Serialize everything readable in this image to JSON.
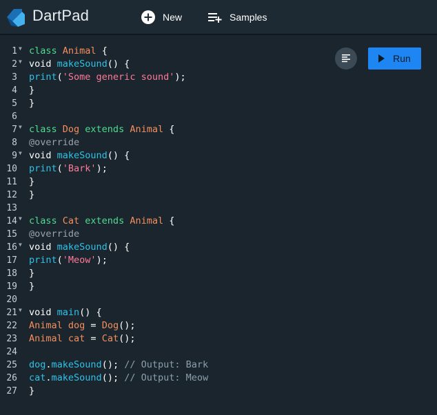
{
  "header": {
    "title": "DartPad",
    "new_label": "New",
    "samples_label": "Samples"
  },
  "toolbar": {
    "run_label": "Run",
    "format_icon": "format-align-icon"
  },
  "colors": {
    "keyword": "#4fdc91",
    "type": "#f58f5e",
    "function": "#2fc2e8",
    "string": "#ff7a99",
    "comment": "#8aa0ad",
    "run_button": "#1d86f2"
  },
  "code": {
    "lines": [
      {
        "n": "1",
        "fold": true,
        "parts": [
          [
            "kw",
            "class "
          ],
          [
            "ty",
            "Animal"
          ],
          [
            "pl",
            " {"
          ]
        ]
      },
      {
        "n": "2",
        "fold": true,
        "parts": [
          [
            "vd",
            "void "
          ],
          [
            "fn",
            "makeSound"
          ],
          [
            "pl",
            "() {"
          ]
        ]
      },
      {
        "n": "3",
        "fold": false,
        "parts": [
          [
            "fn",
            "print"
          ],
          [
            "pl",
            "("
          ],
          [
            "str",
            "'Some generic sound'"
          ],
          [
            "pl",
            ");"
          ]
        ]
      },
      {
        "n": "4",
        "fold": false,
        "parts": [
          [
            "pl",
            "}"
          ]
        ]
      },
      {
        "n": "5",
        "fold": false,
        "parts": [
          [
            "pl",
            "}"
          ]
        ]
      },
      {
        "n": "6",
        "fold": false,
        "parts": []
      },
      {
        "n": "7",
        "fold": true,
        "parts": [
          [
            "kw",
            "class "
          ],
          [
            "ty",
            "Dog "
          ],
          [
            "kw",
            "extends "
          ],
          [
            "ty",
            "Animal"
          ],
          [
            "pl",
            " {"
          ]
        ]
      },
      {
        "n": "8",
        "fold": false,
        "parts": [
          [
            "an",
            "@override"
          ]
        ]
      },
      {
        "n": "9",
        "fold": true,
        "parts": [
          [
            "vd",
            "void "
          ],
          [
            "fn",
            "makeSound"
          ],
          [
            "pl",
            "() {"
          ]
        ]
      },
      {
        "n": "10",
        "fold": false,
        "parts": [
          [
            "fn",
            "print"
          ],
          [
            "pl",
            "("
          ],
          [
            "str",
            "'Bark'"
          ],
          [
            "pl",
            ");"
          ]
        ]
      },
      {
        "n": "11",
        "fold": false,
        "parts": [
          [
            "pl",
            "}"
          ]
        ]
      },
      {
        "n": "12",
        "fold": false,
        "parts": [
          [
            "pl",
            "}"
          ]
        ]
      },
      {
        "n": "13",
        "fold": false,
        "parts": []
      },
      {
        "n": "14",
        "fold": true,
        "parts": [
          [
            "kw",
            "class "
          ],
          [
            "ty",
            "Cat "
          ],
          [
            "kw",
            "extends "
          ],
          [
            "ty",
            "Animal"
          ],
          [
            "pl",
            " {"
          ]
        ]
      },
      {
        "n": "15",
        "fold": false,
        "parts": [
          [
            "an",
            "@override"
          ]
        ]
      },
      {
        "n": "16",
        "fold": true,
        "parts": [
          [
            "vd",
            "void "
          ],
          [
            "fn",
            "makeSound"
          ],
          [
            "pl",
            "() {"
          ]
        ]
      },
      {
        "n": "17",
        "fold": false,
        "parts": [
          [
            "fn",
            "print"
          ],
          [
            "pl",
            "("
          ],
          [
            "str",
            "'Meow'"
          ],
          [
            "pl",
            ");"
          ]
        ]
      },
      {
        "n": "18",
        "fold": false,
        "parts": [
          [
            "pl",
            "}"
          ]
        ]
      },
      {
        "n": "19",
        "fold": false,
        "parts": [
          [
            "pl",
            "}"
          ]
        ]
      },
      {
        "n": "20",
        "fold": false,
        "parts": []
      },
      {
        "n": "21",
        "fold": true,
        "parts": [
          [
            "vd",
            "void "
          ],
          [
            "fn",
            "main"
          ],
          [
            "pl",
            "() {"
          ]
        ]
      },
      {
        "n": "22",
        "fold": false,
        "parts": [
          [
            "ty",
            "Animal "
          ],
          [
            "ty",
            "dog"
          ],
          [
            "pl",
            " = "
          ],
          [
            "ty",
            "Dog"
          ],
          [
            "pl",
            "();"
          ]
        ]
      },
      {
        "n": "23",
        "fold": false,
        "parts": [
          [
            "ty",
            "Animal "
          ],
          [
            "ty",
            "cat"
          ],
          [
            "pl",
            " = "
          ],
          [
            "ty",
            "Cat"
          ],
          [
            "pl",
            "();"
          ]
        ]
      },
      {
        "n": "24",
        "fold": false,
        "parts": []
      },
      {
        "n": "25",
        "fold": false,
        "parts": [
          [
            "fn",
            "dog"
          ],
          [
            "pl",
            "."
          ],
          [
            "fn",
            "makeSound"
          ],
          [
            "pl",
            "(); "
          ],
          [
            "cm",
            "// Output: Bark"
          ]
        ]
      },
      {
        "n": "26",
        "fold": false,
        "parts": [
          [
            "fn",
            "cat"
          ],
          [
            "pl",
            "."
          ],
          [
            "fn",
            "makeSound"
          ],
          [
            "pl",
            "(); "
          ],
          [
            "cm",
            "// Output: Meow"
          ]
        ]
      },
      {
        "n": "27",
        "fold": false,
        "parts": [
          [
            "pl",
            "}"
          ]
        ]
      }
    ]
  }
}
